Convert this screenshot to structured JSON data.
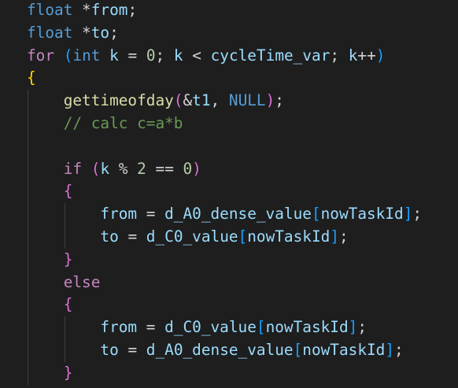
{
  "editor": {
    "theme_colors": {
      "background": "#1e1e1e",
      "keyword": "#569cd6",
      "control": "#c586c0",
      "identifier": "#9cdcfe",
      "function": "#dcdcaa",
      "number": "#b5cea8",
      "comment": "#6a9955",
      "bracket_level1": "#ffd700",
      "bracket_level2": "#da70d6",
      "bracket_level3": "#179fff"
    },
    "lines": [
      [
        [
          "kw",
          "float"
        ],
        [
          "op",
          " *"
        ],
        [
          "id",
          "from"
        ],
        [
          "op",
          ";"
        ]
      ],
      [
        [
          "kw",
          "float"
        ],
        [
          "op",
          " *"
        ],
        [
          "id",
          "to"
        ],
        [
          "op",
          ";"
        ]
      ],
      [
        [
          "ctl",
          "for"
        ],
        [
          "op",
          " "
        ],
        [
          "b3",
          "("
        ],
        [
          "kw",
          "int"
        ],
        [
          "op",
          " "
        ],
        [
          "id",
          "k"
        ],
        [
          "op",
          " = "
        ],
        [
          "num",
          "0"
        ],
        [
          "op",
          "; "
        ],
        [
          "id",
          "k"
        ],
        [
          "op",
          " < "
        ],
        [
          "id",
          "cycleTime_var"
        ],
        [
          "op",
          "; "
        ],
        [
          "id",
          "k"
        ],
        [
          "op",
          "++"
        ],
        [
          "b3",
          ")"
        ]
      ],
      [
        [
          "b1",
          "{"
        ]
      ],
      [
        [
          "op",
          "    "
        ],
        [
          "fn",
          "gettimeofday"
        ],
        [
          "b2",
          "("
        ],
        [
          "op",
          "&"
        ],
        [
          "id",
          "t1"
        ],
        [
          "op",
          ", "
        ],
        [
          "kw",
          "NULL"
        ],
        [
          "b2",
          ")"
        ],
        [
          "op",
          ";"
        ]
      ],
      [
        [
          "op",
          "    "
        ],
        [
          "cm",
          "// calc c=a*b"
        ]
      ],
      [],
      [
        [
          "op",
          "    "
        ],
        [
          "ctl",
          "if"
        ],
        [
          "op",
          " "
        ],
        [
          "b2",
          "("
        ],
        [
          "id",
          "k"
        ],
        [
          "op",
          " % "
        ],
        [
          "num",
          "2"
        ],
        [
          "op",
          " == "
        ],
        [
          "num",
          "0"
        ],
        [
          "b2",
          ")"
        ]
      ],
      [
        [
          "op",
          "    "
        ],
        [
          "b2",
          "{"
        ]
      ],
      [
        [
          "op",
          "        "
        ],
        [
          "id",
          "from"
        ],
        [
          "op",
          " = "
        ],
        [
          "id",
          "d_A0_dense_value"
        ],
        [
          "b3",
          "["
        ],
        [
          "id",
          "nowTaskId"
        ],
        [
          "b3",
          "]"
        ],
        [
          "op",
          ";"
        ]
      ],
      [
        [
          "op",
          "        "
        ],
        [
          "id",
          "to"
        ],
        [
          "op",
          " = "
        ],
        [
          "id",
          "d_C0_value"
        ],
        [
          "b3",
          "["
        ],
        [
          "id",
          "nowTaskId"
        ],
        [
          "b3",
          "]"
        ],
        [
          "op",
          ";"
        ]
      ],
      [
        [
          "op",
          "    "
        ],
        [
          "b2",
          "}"
        ]
      ],
      [
        [
          "op",
          "    "
        ],
        [
          "ctl",
          "else"
        ]
      ],
      [
        [
          "op",
          "    "
        ],
        [
          "b2",
          "{"
        ]
      ],
      [
        [
          "op",
          "        "
        ],
        [
          "id",
          "from"
        ],
        [
          "op",
          " = "
        ],
        [
          "id",
          "d_C0_value"
        ],
        [
          "b3",
          "["
        ],
        [
          "id",
          "nowTaskId"
        ],
        [
          "b3",
          "]"
        ],
        [
          "op",
          ";"
        ]
      ],
      [
        [
          "op",
          "        "
        ],
        [
          "id",
          "to"
        ],
        [
          "op",
          " = "
        ],
        [
          "id",
          "d_A0_dense_value"
        ],
        [
          "b3",
          "["
        ],
        [
          "id",
          "nowTaskId"
        ],
        [
          "b3",
          "]"
        ],
        [
          "op",
          ";"
        ]
      ],
      [
        [
          "op",
          "    "
        ],
        [
          "b2",
          "}"
        ]
      ]
    ]
  }
}
